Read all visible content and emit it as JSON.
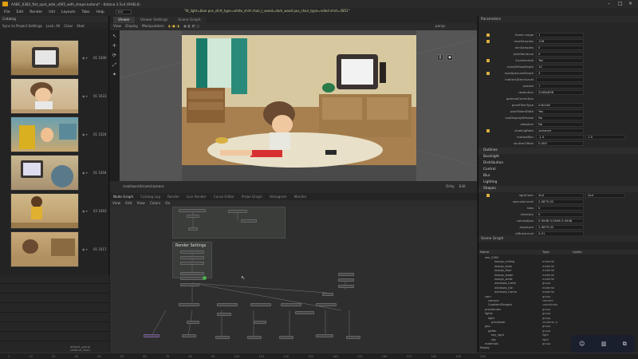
{
  "window": {
    "title": "AABC_0383_flat_spot_adol_v005_with_shape.katana* - Katana 3.5v4 (RHEL6)",
    "shelf_info": "\"lit_light=blue pos_shirt_type=white_shirt chair_I_wood=dark_wood pos_chair_type=rolled shirt=3851\"",
    "frame_field": "100"
  },
  "menu": [
    "File",
    "Edit",
    "Render",
    "Util",
    "Layouts",
    "Tabs",
    "Help"
  ],
  "catalog": {
    "title": "Catalog",
    "toolbar": [
      "Sync to Project Settings",
      "Lock: All",
      "Clear",
      "Shot"
    ],
    "thumbnails": [
      {
        "label": "01 1000"
      },
      {
        "label": "01 1023"
      },
      {
        "label": "01 1024"
      },
      {
        "label": "01 1004"
      },
      {
        "label": "03 1003"
      },
      {
        "label": "01 1017"
      }
    ],
    "footer_text": "default_group (default_shot)"
  },
  "viewer": {
    "tabs": [
      "Viewer",
      "Viewer Settings",
      "Scene Graph"
    ],
    "toolbar": [
      "View",
      "Display",
      "Manipulators"
    ],
    "camera_label": "persp",
    "status_text": "/root/world/cam/camera",
    "status_right": [
      "Dirty",
      "Edit"
    ]
  },
  "nodegraph": {
    "tabs": [
      "Node Graph",
      "Catalog Log",
      "Render",
      "Live Render",
      "Curve Editor",
      "Probe Graph",
      "Histogram",
      "Monitor"
    ],
    "menu": [
      "View",
      "Edit",
      "View",
      "Colors",
      "Go"
    ],
    "backdrop_title": "Render Settings"
  },
  "params": {
    "title": "Parameters",
    "rows": [
      {
        "label": "frame range",
        "value": "1"
      },
      {
        "label": "maxSamples",
        "value": "128"
      },
      {
        "label": "minSamples",
        "value": "0"
      },
      {
        "label": "pixelVariance",
        "value": "0"
      },
      {
        "label": "incremental",
        "value": "Yes"
      },
      {
        "label": "maxDiffuseDepth",
        "value": "10"
      },
      {
        "label": "maxSpecularDepth",
        "value": "4"
      },
      {
        "label": "indirectDirectLevel",
        "value": ""
      },
      {
        "label": "passes",
        "value": "1"
      },
      {
        "label": "resolution",
        "value": "2048x858"
      },
      {
        "label": "gammaCorrection",
        "value": ""
      },
      {
        "label": "pixelFilterType",
        "value": "mitchell"
      },
      {
        "label": "pixelFilterWidth",
        "value": "Yes"
      },
      {
        "label": "useDisplayWindow",
        "value": "No"
      },
      {
        "label": "adaptive",
        "value": "No"
      },
      {
        "label": "shadingRate",
        "value": "variance"
      },
      {
        "label": "motionBlur",
        "value": "-1.5",
        "value2": "1.5"
      },
      {
        "label": "shutterOffset",
        "value": "0.000"
      }
    ],
    "sections": [
      "Outlines",
      "Backlight",
      "Distribution",
      "Control",
      "Blur",
      "Lighting",
      "Shapes"
    ],
    "sub_rows": [
      {
        "label": "lightColor",
        "value": "4x4",
        "value2": "4x4"
      },
      {
        "label": "specularLevel",
        "value": "2.0875.02"
      },
      {
        "label": "bias",
        "value": "0"
      },
      {
        "label": "intensity",
        "value": "0"
      },
      {
        "label": "colorAdjust",
        "value": "0.0948 0.0948 0.0948"
      },
      {
        "label": "exposure",
        "value": "2.0875.02"
      },
      {
        "label": "diffuseLevel",
        "value": "0.01"
      },
      {
        "label": "specularMult",
        "value": "2.0875.02"
      },
      {
        "label": "lightGroup",
        "value": "2.0875.02"
      }
    ]
  },
  "scenegraph": {
    "title": "Scene Graph",
    "header": [
      "Name",
      "Type",
      "Lights"
    ],
    "rows": [
      {
        "name": "aas_0383",
        "type": "",
        "indent": 2
      },
      {
        "name": "lowrgs_ceiling",
        "type": "material",
        "indent": 5
      },
      {
        "name": "lowrgs_stool",
        "type": "material",
        "indent": 5
      },
      {
        "name": "lowrgs_floor",
        "type": "material",
        "indent": 5
      },
      {
        "name": "lowrgs_water",
        "type": "material",
        "indent": 5
      },
      {
        "name": "lowrgs_walls",
        "type": "material",
        "indent": 5
      },
      {
        "name": "windows_mesh",
        "type": "group",
        "indent": 5
      },
      {
        "name": "windows_tile",
        "type": "material",
        "indent": 5
      },
      {
        "name": "windows_frame",
        "type": "material",
        "indent": 5
      },
      {
        "name": "cam",
        "type": "group",
        "indent": 2
      },
      {
        "name": "camera",
        "type": "camera",
        "indent": 3
      },
      {
        "name": "CookieInfTangels",
        "type": "coordinate",
        "indent": 3
      },
      {
        "name": "procedures",
        "type": "group",
        "indent": 2
      },
      {
        "name": "lights",
        "type": "group",
        "indent": 2
      },
      {
        "name": "light",
        "type": "group",
        "indent": 3
      },
      {
        "name": "previewer",
        "type": "renderer p",
        "indent": 4
      },
      {
        "name": "geo",
        "type": "group",
        "indent": 2
      },
      {
        "name": "gaffer",
        "type": "group",
        "indent": 3
      },
      {
        "name": "key_light",
        "type": "light",
        "indent": 4
      },
      {
        "name": "sky",
        "type": "light",
        "indent": 4
      },
      {
        "name": "materials",
        "type": "group",
        "indent": 2
      }
    ],
    "footer": "Ready"
  },
  "timeline": [
    "1",
    "10",
    "20",
    "30",
    "40",
    "50",
    "60",
    "70",
    "80",
    "90",
    "100",
    "110",
    "120",
    "130",
    "140",
    "150",
    "160",
    "170",
    "180",
    "190",
    "200"
  ]
}
